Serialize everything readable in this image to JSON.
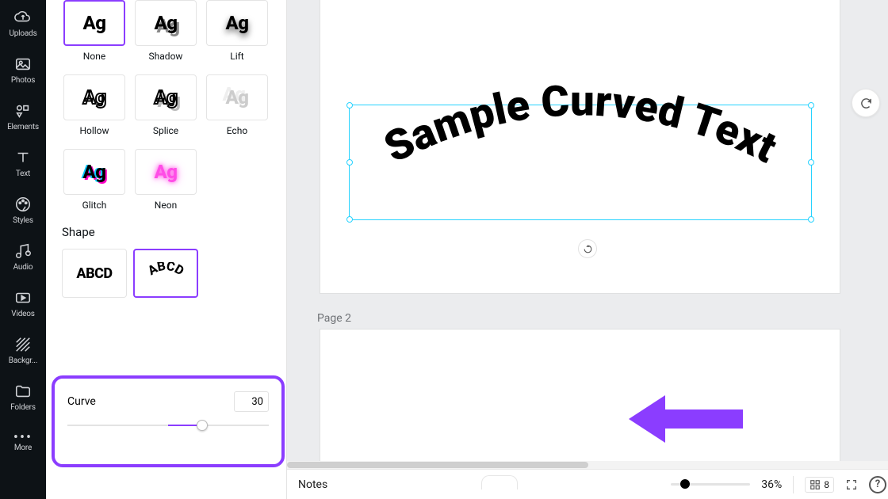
{
  "nav": {
    "items": [
      {
        "label": "Uploads",
        "icon": "uploads-icon"
      },
      {
        "label": "Photos",
        "icon": "photos-icon"
      },
      {
        "label": "Elements",
        "icon": "elements-icon"
      },
      {
        "label": "Text",
        "icon": "text-icon"
      },
      {
        "label": "Styles",
        "icon": "styles-icon"
      },
      {
        "label": "Audio",
        "icon": "audio-icon"
      },
      {
        "label": "Videos",
        "icon": "videos-icon"
      },
      {
        "label": "Backgr...",
        "icon": "background-icon"
      },
      {
        "label": "Folders",
        "icon": "folders-icon"
      },
      {
        "label": "More",
        "icon": "more-icon"
      }
    ]
  },
  "panel": {
    "effects": [
      {
        "label": "None",
        "sample": "Ag",
        "selected": true,
        "style": "none"
      },
      {
        "label": "Shadow",
        "sample": "Ag",
        "selected": false,
        "style": "shadow"
      },
      {
        "label": "Lift",
        "sample": "Ag",
        "selected": false,
        "style": "lift"
      },
      {
        "label": "Hollow",
        "sample": "Ag",
        "selected": false,
        "style": "hollow"
      },
      {
        "label": "Splice",
        "sample": "Ag",
        "selected": false,
        "style": "splice"
      },
      {
        "label": "Echo",
        "sample": "Ag",
        "selected": false,
        "style": "echo"
      },
      {
        "label": "Glitch",
        "sample": "Ag",
        "selected": false,
        "style": "glitch"
      },
      {
        "label": "Neon",
        "sample": "Ag",
        "selected": false,
        "style": "neon"
      }
    ],
    "shape_heading": "Shape",
    "shapes": [
      {
        "label": "",
        "sample": "ABCD",
        "selected": false,
        "style": "flat"
      },
      {
        "label": "",
        "sample": "ABCD",
        "selected": true,
        "style": "curve"
      }
    ],
    "curve": {
      "label": "Curve",
      "value": "30"
    }
  },
  "canvas": {
    "text_content": "Sample Curved Text",
    "page2_label": "Page 2"
  },
  "bottom": {
    "notes_label": "Notes",
    "zoom_label": "36%",
    "page_count": "8"
  },
  "colors": {
    "accent": "#8b3dff",
    "selection": "#27d3ff"
  }
}
